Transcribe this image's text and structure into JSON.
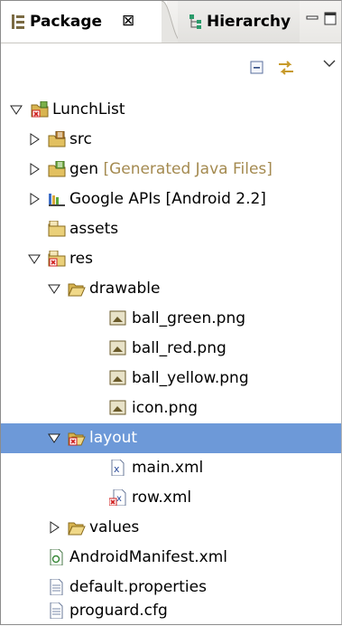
{
  "tabs": [
    {
      "label": "Package",
      "close_glyph": "⊠",
      "icon": "package-explorer-icon"
    },
    {
      "label": "Hierarchy",
      "icon": "hierarchy-icon"
    }
  ],
  "toolbar": {
    "collapse_all": "collapse-all-icon",
    "link_with_editor": "link-with-editor-icon",
    "view_menu": "view-menu-icon"
  },
  "tree": [
    {
      "label": "LunchList",
      "icon": "android-project-icon",
      "expanded": true
    },
    {
      "label": "src",
      "icon": "source-folder-icon",
      "expanded": false
    },
    {
      "label": "gen",
      "decoration": "[Generated Java Files]",
      "icon": "generated-folder-icon",
      "expanded": false
    },
    {
      "label": "Google APIs [Android 2.2]",
      "icon": "library-icon",
      "expanded": false
    },
    {
      "label": "assets",
      "icon": "folder-icon"
    },
    {
      "label": "res",
      "icon": "error-folder-icon",
      "expanded": true
    },
    {
      "label": "drawable",
      "icon": "folder-icon",
      "expanded": true
    },
    {
      "label": "ball_green.png",
      "icon": "image-file-icon"
    },
    {
      "label": "ball_red.png",
      "icon": "image-file-icon"
    },
    {
      "label": "ball_yellow.png",
      "icon": "image-file-icon"
    },
    {
      "label": "icon.png",
      "icon": "image-file-icon"
    },
    {
      "label": "layout",
      "icon": "error-folder-icon",
      "expanded": true,
      "selected": true
    },
    {
      "label": "main.xml",
      "icon": "xml-file-icon"
    },
    {
      "label": "row.xml",
      "icon": "xml-error-file-icon"
    },
    {
      "label": "values",
      "icon": "folder-icon",
      "expanded": false
    },
    {
      "label": "AndroidManifest.xml",
      "icon": "manifest-icon"
    },
    {
      "label": "default.properties",
      "icon": "text-file-icon"
    },
    {
      "label": "proguard.cfg",
      "icon": "text-file-icon"
    }
  ],
  "colors": {
    "selection": "#6d99d8",
    "decoration": "#a48a50",
    "error": "#d02020"
  }
}
